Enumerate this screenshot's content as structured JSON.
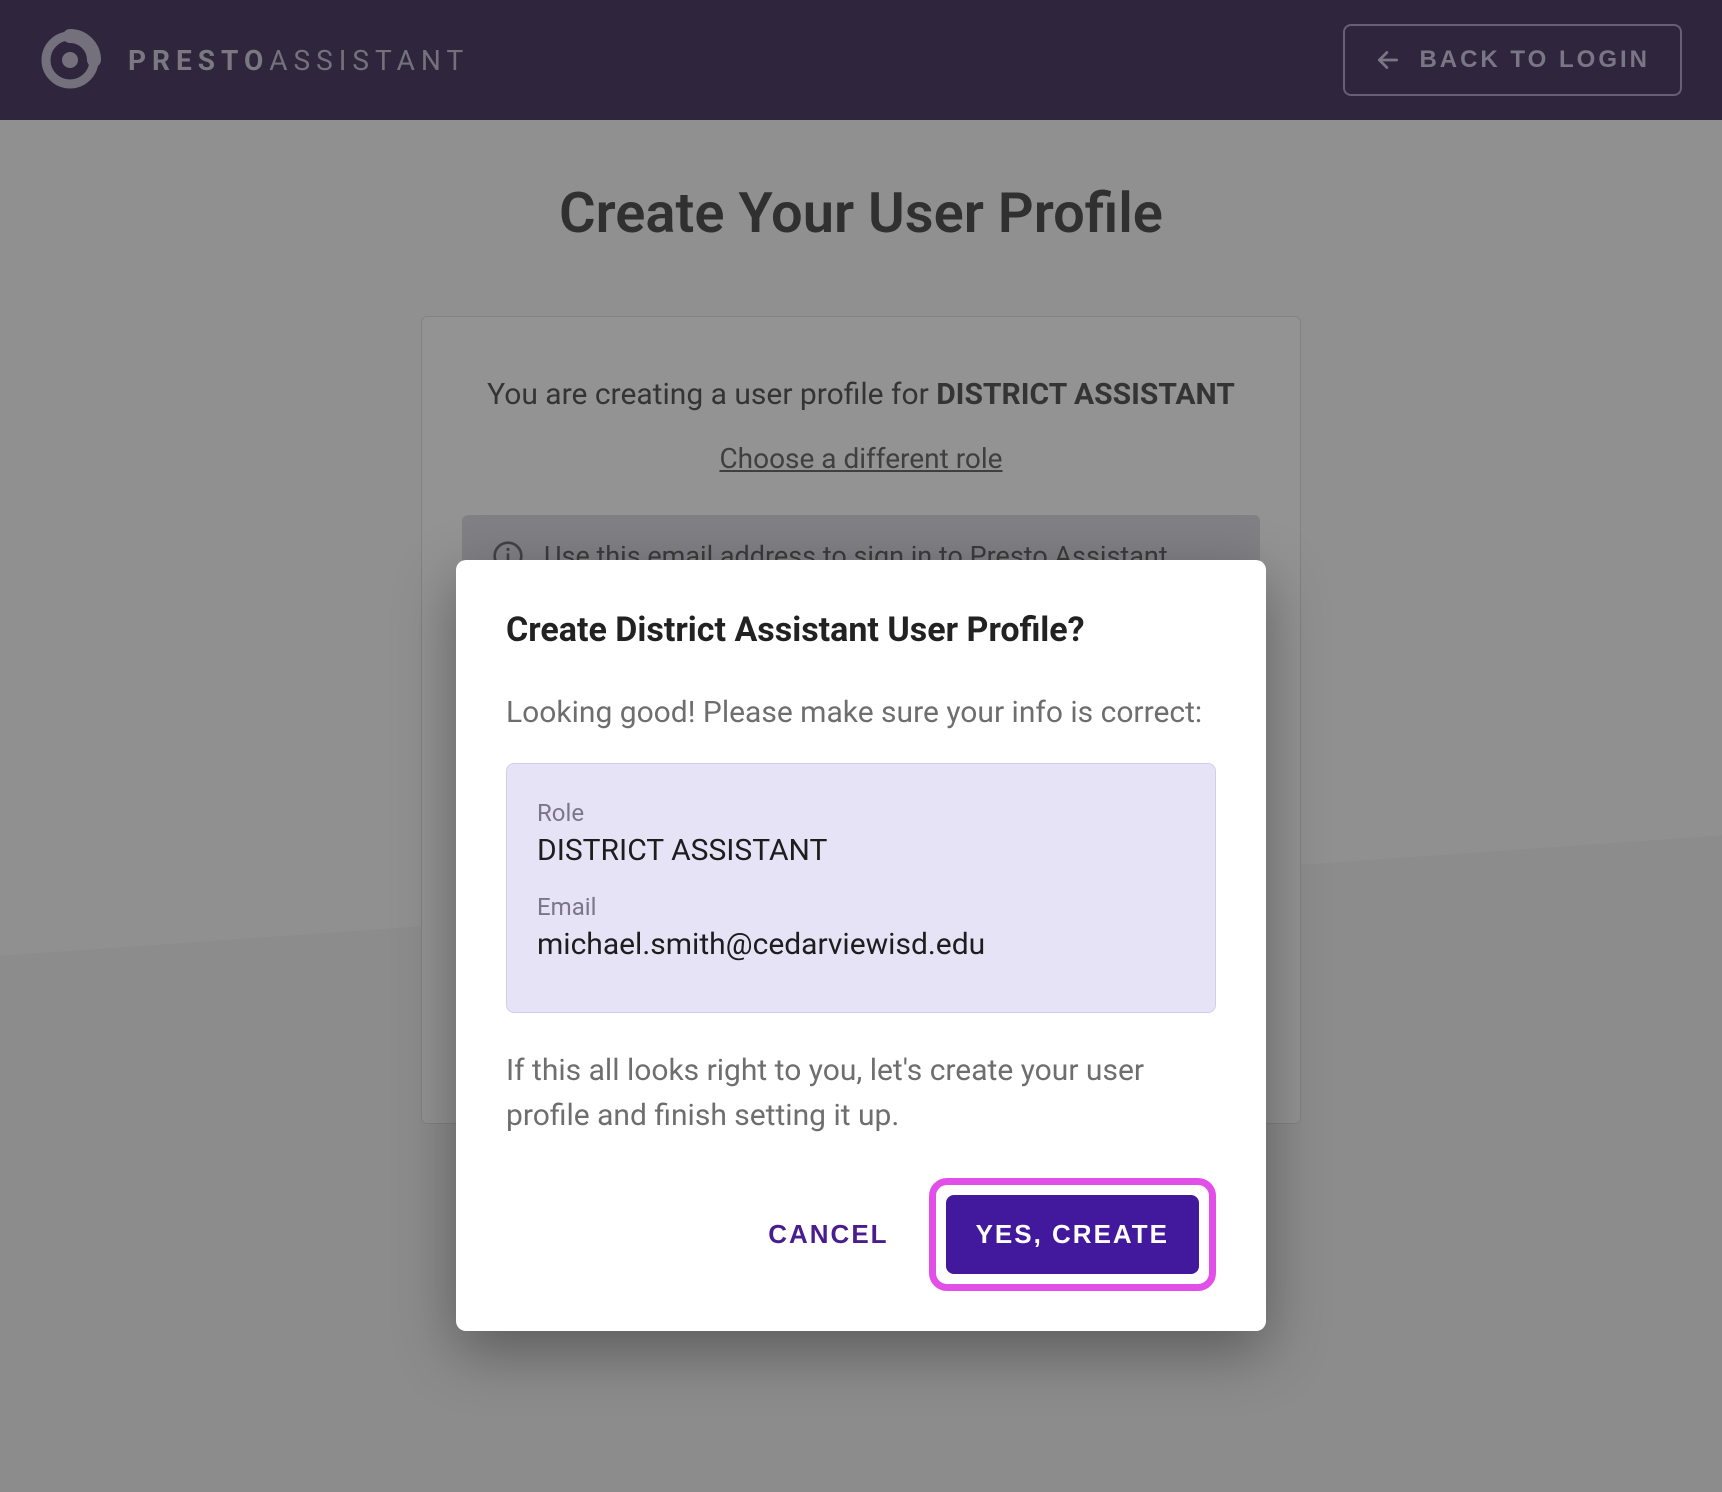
{
  "header": {
    "logo_bold": "PRESTO",
    "logo_light": "ASSISTANT",
    "back_label": "BACK TO LOGIN"
  },
  "page": {
    "title": "Create Your User Profile"
  },
  "card": {
    "creating_prefix": "You are creating a user profile for ",
    "creating_role": "DISTRICT ASSISTANT",
    "choose_different": "Choose a different role",
    "info_text": "Use this email address to sign in to Presto Assistant."
  },
  "modal": {
    "title": "Create District Assistant User Profile?",
    "lead": "Looking good! Please make sure your info is correct:",
    "role_label": "Role",
    "role_value": "DISTRICT ASSISTANT",
    "email_label": "Email",
    "email_value": "michael.smith@cedarviewisd.edu",
    "footer": "If this all looks right to you, let's create your user profile and finish setting it up.",
    "cancel": "CANCEL",
    "confirm": "YES, CREATE"
  }
}
